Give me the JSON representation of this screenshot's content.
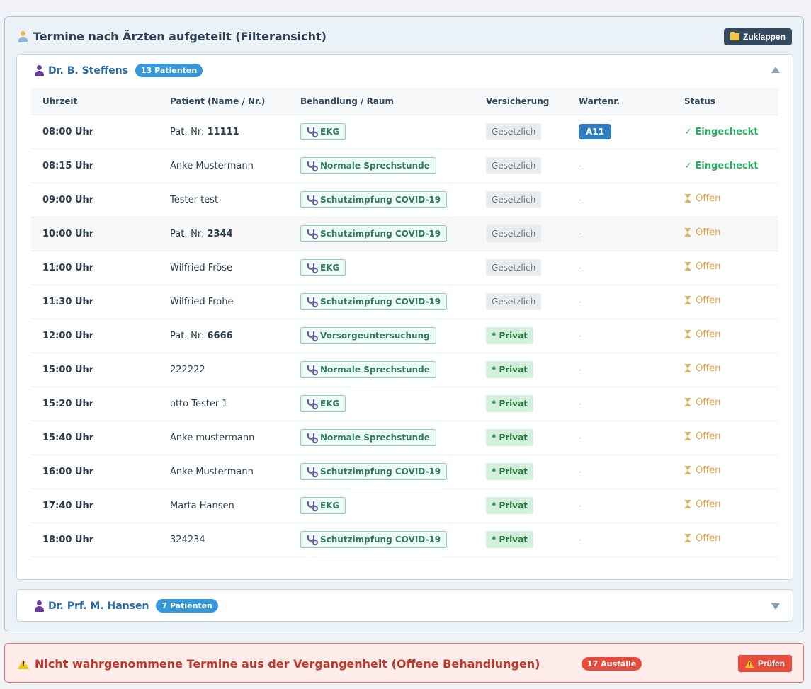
{
  "panel": {
    "title": "Termine nach Ärzten aufgeteilt (Filteransicht)",
    "collapse_label": "Zuklappen"
  },
  "doctors": [
    {
      "name": "Dr. B. Steffens",
      "patients_badge": "13 Patienten",
      "expanded": true,
      "columns": [
        "Uhrzeit",
        "Patient (Name / Nr.)",
        "Behandlung / Raum",
        "Versicherung",
        "Wartenr.",
        "Status"
      ],
      "rows": [
        {
          "time": "08:00 Uhr",
          "patient_prefix": "Pat.-Nr: ",
          "patient": "11111",
          "treatment": "EKG",
          "insurance": "Gesetzlich",
          "insurance_type": "public",
          "wait": "A11",
          "status": "✓ Eingecheckt",
          "status_type": "in"
        },
        {
          "time": "08:15 Uhr",
          "patient_prefix": "",
          "patient": "Anke Mustermann",
          "treatment": "Normale Sprechstunde",
          "insurance": "Gesetzlich",
          "insurance_type": "public",
          "wait": "-",
          "status": "✓ Eingecheckt",
          "status_type": "in"
        },
        {
          "time": "09:00 Uhr",
          "patient_prefix": "",
          "patient": "Tester test",
          "treatment": "Schutzimpfung COVID-19",
          "insurance": "Gesetzlich",
          "insurance_type": "public",
          "wait": "-",
          "status": "Offen",
          "status_type": "open"
        },
        {
          "time": "10:00 Uhr",
          "patient_prefix": "Pat.-Nr: ",
          "patient": "2344",
          "treatment": "Schutzimpfung COVID-19",
          "insurance": "Gesetzlich",
          "insurance_type": "public",
          "wait": "-",
          "status": "Offen",
          "status_type": "open"
        },
        {
          "time": "11:00 Uhr",
          "patient_prefix": "",
          "patient": "Wilfried Fröse",
          "treatment": "EKG",
          "insurance": "Gesetzlich",
          "insurance_type": "public",
          "wait": "-",
          "status": "Offen",
          "status_type": "open"
        },
        {
          "time": "11:30 Uhr",
          "patient_prefix": "",
          "patient": "Wilfried Frohe",
          "treatment": "Schutzimpfung COVID-19",
          "insurance": "Gesetzlich",
          "insurance_type": "public",
          "wait": "-",
          "status": "Offen",
          "status_type": "open"
        },
        {
          "time": "12:00 Uhr",
          "patient_prefix": "Pat.-Nr: ",
          "patient": "6666",
          "treatment": "Vorsorgeuntersuchung",
          "insurance": "* Privat",
          "insurance_type": "private",
          "wait": "-",
          "status": "Offen",
          "status_type": "open"
        },
        {
          "time": "15:00 Uhr",
          "patient_prefix": "",
          "patient": "222222",
          "treatment": "Normale Sprechstunde",
          "insurance": "* Privat",
          "insurance_type": "private",
          "wait": "-",
          "status": "Offen",
          "status_type": "open"
        },
        {
          "time": "15:20 Uhr",
          "patient_prefix": "",
          "patient": "otto Tester 1",
          "treatment": "EKG",
          "insurance": "* Privat",
          "insurance_type": "private",
          "wait": "-",
          "status": "Offen",
          "status_type": "open"
        },
        {
          "time": "15:40 Uhr",
          "patient_prefix": "",
          "patient": "Anke mustermann",
          "treatment": "Normale Sprechstunde",
          "insurance": "* Privat",
          "insurance_type": "private",
          "wait": "-",
          "status": "Offen",
          "status_type": "open"
        },
        {
          "time": "16:00 Uhr",
          "patient_prefix": "",
          "patient": "Anke Mustermann",
          "treatment": "Schutzimpfung COVID-19",
          "insurance": "* Privat",
          "insurance_type": "private",
          "wait": "-",
          "status": "Offen",
          "status_type": "open"
        },
        {
          "time": "17:40 Uhr",
          "patient_prefix": "",
          "patient": "Marta Hansen",
          "treatment": "EKG",
          "insurance": "* Privat",
          "insurance_type": "private",
          "wait": "-",
          "status": "Offen",
          "status_type": "open"
        },
        {
          "time": "18:00 Uhr",
          "patient_prefix": "",
          "patient": "324234",
          "treatment": "Schutzimpfung COVID-19",
          "insurance": "* Privat",
          "insurance_type": "private",
          "wait": "-",
          "status": "Offen",
          "status_type": "open"
        }
      ]
    },
    {
      "name": "Dr. Prf. M. Hansen",
      "patients_badge": "7 Patienten",
      "expanded": false
    }
  ],
  "alert": {
    "title": "Nicht wahrgenommene Termine aus der Vergangenheit (Offene Behandlungen)",
    "count_badge": "17 Ausfälle",
    "check_label": "Prüfen"
  },
  "colors": {
    "accent": "#3498db",
    "doctor_name": "#2e6da4",
    "checked_in": "#27ae60",
    "open": "#e6a23c",
    "alert": "#c0392b",
    "person_icon_panel": "#f0b24a",
    "person_icon_doctor": "#6a3d9a"
  },
  "icons": {
    "panel": "person-icon",
    "collapse": "folder-icon",
    "doctor": "person-icon",
    "treatment": "stethoscope-icon",
    "open": "hourglass-icon",
    "alert": "warning-icon"
  }
}
